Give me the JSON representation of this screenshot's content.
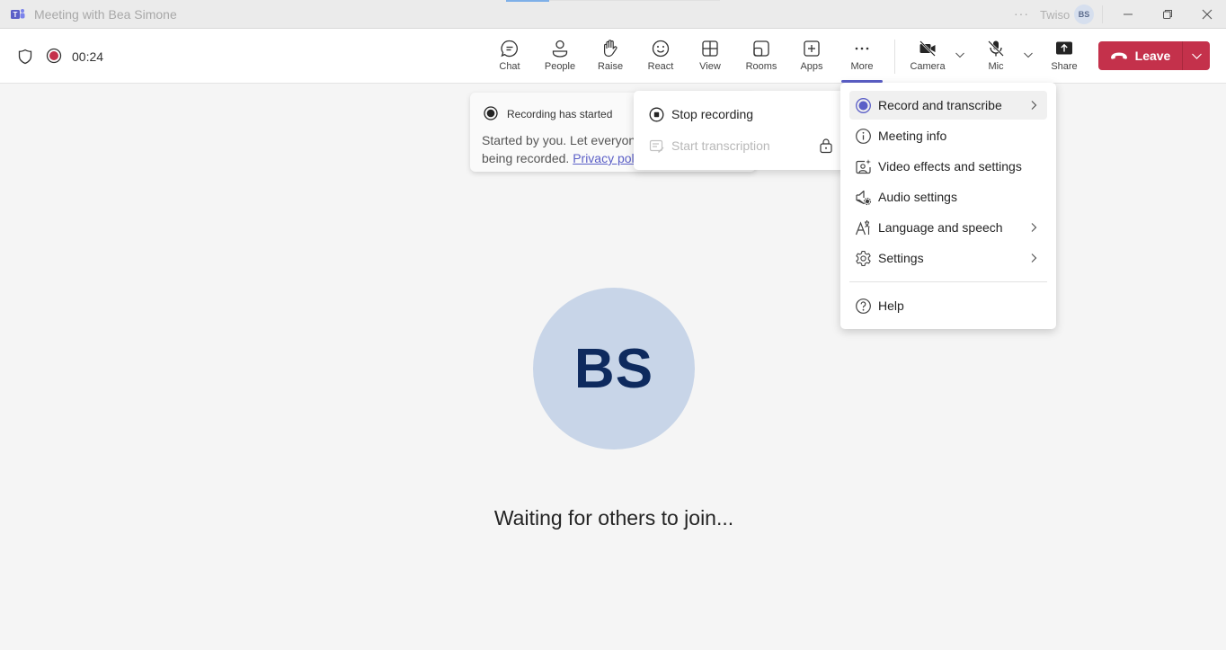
{
  "window": {
    "title": "Meeting with Bea Simone",
    "org_name": "Twiso",
    "account_initials": "BS",
    "more_dots": "···",
    "controls": [
      "minimize",
      "restore",
      "close"
    ]
  },
  "meeting_bar": {
    "timer": "00:24",
    "recording_active": true,
    "buttons": [
      {
        "id": "chat",
        "label": "Chat",
        "icon": "chat-icon"
      },
      {
        "id": "people",
        "label": "People",
        "icon": "people-icon"
      },
      {
        "id": "raise",
        "label": "Raise",
        "icon": "hand-icon"
      },
      {
        "id": "react",
        "label": "React",
        "icon": "smiley-icon"
      },
      {
        "id": "view",
        "label": "View",
        "icon": "grid-icon"
      },
      {
        "id": "rooms",
        "label": "Rooms",
        "icon": "rooms-icon"
      },
      {
        "id": "apps",
        "label": "Apps",
        "icon": "plus-square-icon"
      },
      {
        "id": "more",
        "label": "More",
        "icon": "more-dots-icon",
        "active": true
      }
    ],
    "devices": [
      {
        "id": "camera",
        "label": "Camera",
        "state": "off"
      },
      {
        "id": "mic",
        "label": "Mic",
        "state": "muted"
      }
    ],
    "share_label": "Share",
    "leave_label": "Leave",
    "leave_color": "#c4314b",
    "accent_color": "#5b5fc7"
  },
  "recording_toast": {
    "title": "Recording has started",
    "body_line1": "Started by you. Let everyon",
    "body_line2_prefix": "being recorded. ",
    "link_text": "Privacy pol"
  },
  "record_submenu": {
    "items": [
      {
        "label": "Stop recording",
        "enabled": true
      },
      {
        "label": "Start transcription",
        "enabled": false,
        "locked": true
      }
    ]
  },
  "more_menu": {
    "items": [
      {
        "label": "Record and transcribe",
        "icon": "record-icon",
        "submenu": true,
        "highlighted": true
      },
      {
        "label": "Meeting info",
        "icon": "info-icon",
        "submenu": false
      },
      {
        "label": "Video effects and settings",
        "icon": "video-effects-icon",
        "submenu": false
      },
      {
        "label": "Audio settings",
        "icon": "audio-settings-icon",
        "submenu": false
      },
      {
        "label": "Language and speech",
        "icon": "language-icon",
        "submenu": true
      },
      {
        "label": "Settings",
        "icon": "gear-icon",
        "submenu": true
      }
    ],
    "footer_items": [
      {
        "label": "Help",
        "icon": "help-icon"
      }
    ]
  },
  "stage": {
    "participant_initials": "BS",
    "avatar_color": "#c8d5e8",
    "status_text": "Waiting for others to join..."
  }
}
